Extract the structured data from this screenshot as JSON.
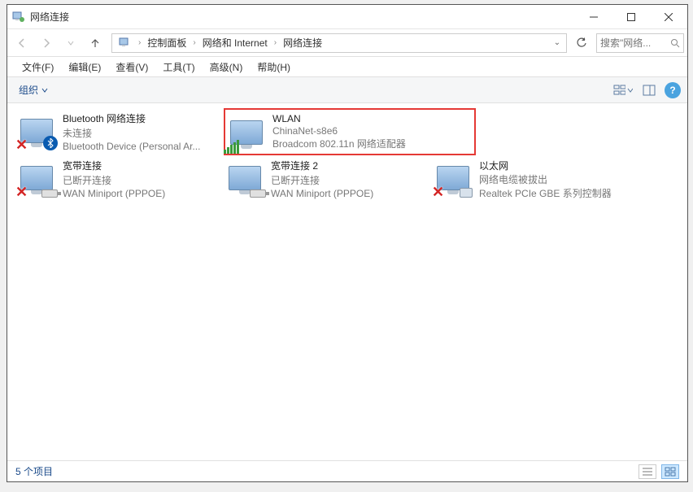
{
  "window": {
    "title": "网络连接"
  },
  "nav": {
    "crumbs": [
      "控制面板",
      "网络和 Internet",
      "网络连接"
    ],
    "search_placeholder": "搜索\"网络..."
  },
  "menu": {
    "file": "文件(F)",
    "edit": "编辑(E)",
    "view": "查看(V)",
    "tools": "工具(T)",
    "advanced": "高级(N)",
    "help": "帮助(H)"
  },
  "toolbar": {
    "organize": "组织"
  },
  "connections": [
    {
      "name": "Bluetooth 网络连接",
      "status": "未连接",
      "device": "Bluetooth Device (Personal Ar...",
      "kind": "bluetooth",
      "error": true
    },
    {
      "name": "WLAN",
      "status": "ChinaNet-s8e6",
      "device": "Broadcom 802.11n 网络适配器",
      "kind": "wifi",
      "highlighted": true
    },
    {
      "name": "宽带连接",
      "status": "已断开连接",
      "device": "WAN Miniport (PPPOE)",
      "kind": "wan",
      "error": true
    },
    {
      "name": "宽带连接 2",
      "status": "已断开连接",
      "device": "WAN Miniport (PPPOE)",
      "kind": "wan"
    },
    {
      "name": "以太网",
      "status": "网络电缆被拔出",
      "device": "Realtek PCIe GBE 系列控制器",
      "kind": "ethernet",
      "error": true
    }
  ],
  "status": {
    "item_count": "5 个项目"
  }
}
